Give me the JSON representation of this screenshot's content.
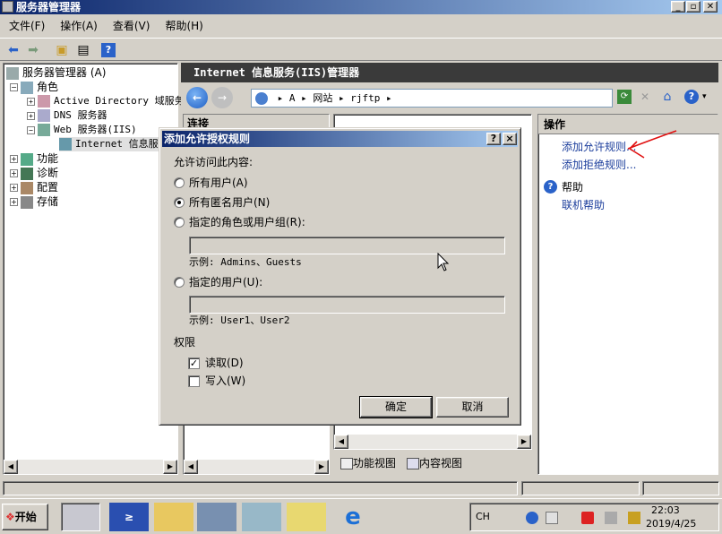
{
  "window": {
    "title": "服务器管理器",
    "min": "_",
    "max": "▫",
    "close": "✕"
  },
  "menu": [
    "文件(F)",
    "操作(A)",
    "查看(V)",
    "帮助(H)"
  ],
  "tree": {
    "root": "服务器管理器 (A)",
    "roles": "角色",
    "ad": "Active Directory 域服务",
    "dns": "DNS 服务器",
    "web": "Web 服务器(IIS)",
    "iis": "Internet 信息服务",
    "features": "功能",
    "diag": "诊断",
    "config": "配置",
    "storage": "存储"
  },
  "main_header": "Internet 信息服务(IIS)管理器",
  "breadcrumb": {
    "a": "A",
    "sites": "网站",
    "site": "rjftp"
  },
  "conn_header": "连接",
  "view_tabs": {
    "feature": "功能视图",
    "content": "内容视图"
  },
  "actions": {
    "header": "操作",
    "add_allow": "添加允许规则...",
    "add_deny": "添加拒绝规则...",
    "help": "帮助",
    "online_help": "联机帮助"
  },
  "dialog": {
    "title": "添加允许授权规则",
    "help_btn": "?",
    "close_btn": "×",
    "prompt": "允许访问此内容:",
    "opt_all": "所有用户(A)",
    "opt_anon": "所有匿名用户(N)",
    "opt_roles": "指定的角色或用户组(R):",
    "roles_value": "",
    "roles_example": "示例: Admins、Guests",
    "opt_users": "指定的用户(U):",
    "users_value": "",
    "users_example": "示例: User1、User2",
    "perm_label": "权限",
    "perm_read": "读取(D)",
    "perm_write": "写入(W)",
    "ok": "确定",
    "cancel": "取消",
    "selected": "anon",
    "read_checked": true,
    "write_checked": false
  },
  "taskbar": {
    "start": "开始",
    "lang": "CH",
    "time": "22:03",
    "date": "2019/4/25"
  }
}
